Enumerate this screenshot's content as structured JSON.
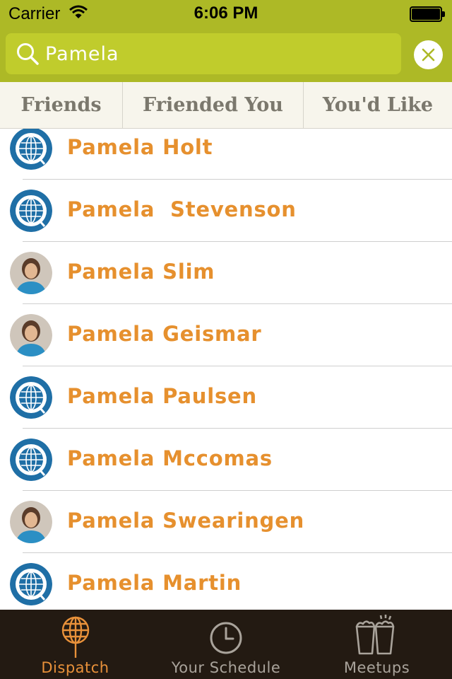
{
  "status_bar": {
    "carrier": "Carrier",
    "time": "6:06 PM"
  },
  "search": {
    "value": "Pamela",
    "placeholder": ""
  },
  "segments": [
    {
      "label": "Friends"
    },
    {
      "label": "Friended You"
    },
    {
      "label": "You'd Like"
    }
  ],
  "results": [
    {
      "name": "Pamela Holt",
      "avatar": "globe-icon"
    },
    {
      "name": "Pamela  Stevenson",
      "avatar": "globe-icon"
    },
    {
      "name": "Pamela Slim",
      "avatar": "profile-photo"
    },
    {
      "name": "Pamela Geismar",
      "avatar": "profile-photo"
    },
    {
      "name": "Pamela Paulsen",
      "avatar": "globe-icon"
    },
    {
      "name": "Pamela Mccomas",
      "avatar": "globe-icon"
    },
    {
      "name": "Pamela Swearingen",
      "avatar": "profile-photo"
    },
    {
      "name": "Pamela Martin",
      "avatar": "globe-icon"
    }
  ],
  "tabbar": [
    {
      "label": "Dispatch",
      "icon": "globe-pin-icon",
      "active": true
    },
    {
      "label": "Your Schedule",
      "icon": "clock-icon",
      "active": false
    },
    {
      "label": "Meetups",
      "icon": "beer-glasses-icon",
      "active": false
    }
  ],
  "colors": {
    "header_bg": "#adb926",
    "search_bg": "#c0cc2c",
    "name_text": "#e6902e",
    "tabbar_bg": "#231a12",
    "tab_active": "#e8913a",
    "tab_inactive": "#a9a39b",
    "globe_blue": "#1f6fa6"
  }
}
